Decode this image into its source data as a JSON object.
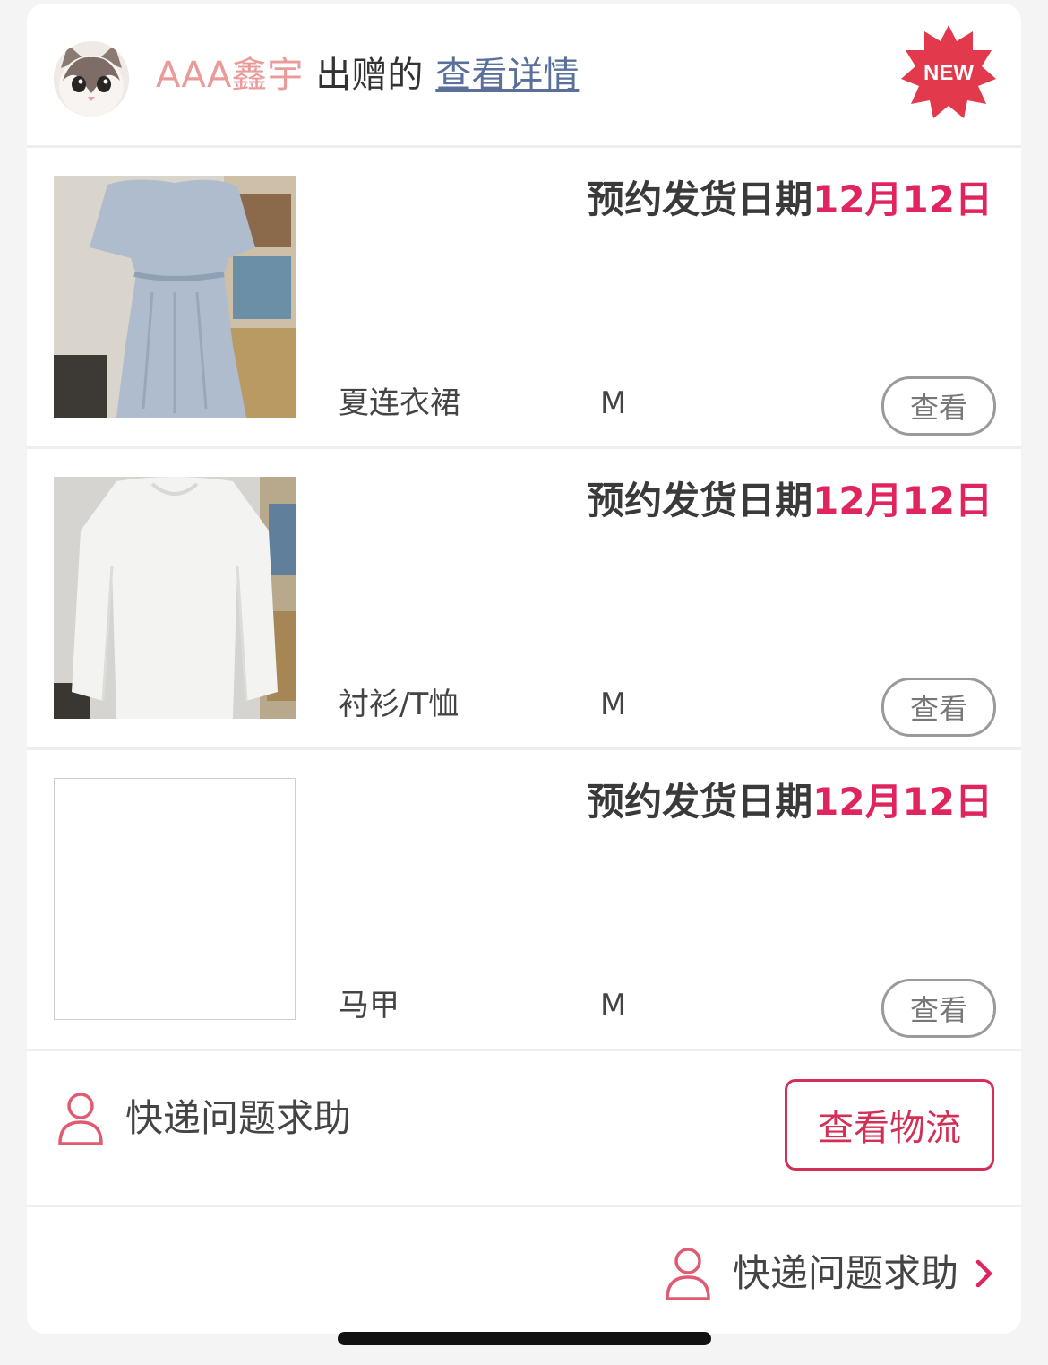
{
  "header": {
    "donor_name": "AAA鑫宇",
    "donate_verb": "出赠的",
    "detail_link": "查看详情",
    "new_badge": "NEW"
  },
  "items": [
    {
      "ship_label": "预约发货日期",
      "ship_date": "12月12日",
      "name": "夏连衣裙",
      "size": "M",
      "view_label": "查看",
      "thumb": "light-blue-dress-photo"
    },
    {
      "ship_label": "预约发货日期",
      "ship_date": "12月12日",
      "name": "衬衫/T恤",
      "size": "M",
      "view_label": "查看",
      "thumb": "white-shirt-photo"
    },
    {
      "ship_label": "预约发货日期",
      "ship_date": "12月12日",
      "name": "马甲",
      "size": "M",
      "view_label": "查看",
      "thumb": "empty-placeholder"
    }
  ],
  "help": {
    "label": "快递问题求助",
    "logistics_button": "查看物流",
    "icon": "person-icon"
  },
  "footer": {
    "label": "快递问题求助",
    "icon": "person-icon",
    "chevron": "chevron-right-icon"
  },
  "colors": {
    "accent_red": "#e0245e",
    "button_red": "#d33058",
    "donor_pink": "#eb9a9a",
    "link_blue": "#5a6f9a",
    "badge_red": "#e23a4c"
  }
}
